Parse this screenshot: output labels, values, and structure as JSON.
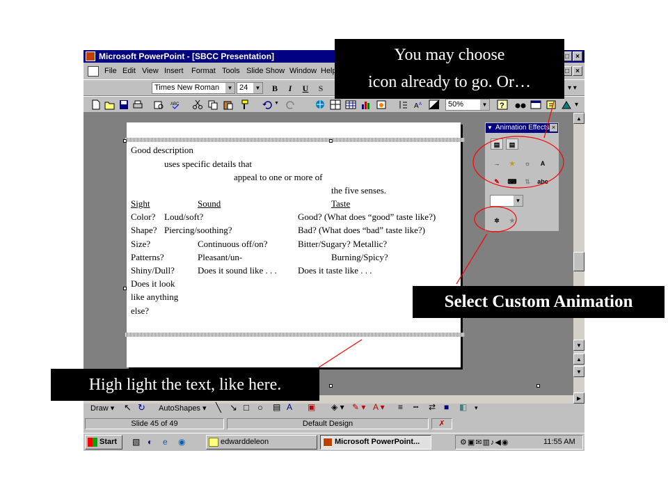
{
  "window": {
    "title": "Microsoft PowerPoint - [SBCC Presentation]"
  },
  "menu": {
    "items": [
      "File",
      "Edit",
      "View",
      "Insert",
      "Format",
      "Tools",
      "Slide Show",
      "Window",
      "Help"
    ]
  },
  "format_toolbar": {
    "font_name": "Times New Roman",
    "font_size": "24",
    "bold": "B",
    "italic": "I",
    "underline": "U",
    "shadow": "S"
  },
  "standard_toolbar": {
    "zoom": "50%"
  },
  "slide": {
    "lines": [
      "Good description",
      "uses specific details that",
      "appeal to one or more of",
      "the five senses."
    ],
    "columns": {
      "sight": {
        "header": "Sight",
        "items": [
          "Color?",
          "Shape?",
          "Size?",
          "Patterns?",
          "Shiny/Dull?",
          "Does it look",
          "like anything",
          "else?"
        ]
      },
      "sound": {
        "header": "Sound",
        "items": [
          "Loud/soft?",
          "Piercing/soothing?",
          "Continuous off/on?",
          "Pleasant/un-",
          "Does it sound like . . ."
        ]
      },
      "taste": {
        "header": "Taste",
        "items": [
          "Good? (What does “good” taste like?)",
          "Bad? (What does “bad” taste like?)",
          "Bitter/Sugary? Metallic?",
          "Burning/Spicy?",
          "Does it taste like . . ."
        ]
      }
    }
  },
  "animation_palette": {
    "title": "Animation Effects"
  },
  "drawing_toolbar": {
    "draw": "Draw",
    "autoshapes": "AutoShapes"
  },
  "status_bar": {
    "slide_info": "Slide 45 of 49",
    "design": "Default Design"
  },
  "taskbar": {
    "start": "Start",
    "tasks": [
      "edwarddeleon",
      "Microsoft PowerPoint..."
    ],
    "clock": "11:55 AM"
  },
  "callouts": {
    "top": [
      "You may choose",
      "icon already to go. Or…"
    ],
    "right": "Select Custom Animation",
    "bottom": "High light the text, like here."
  },
  "colors": {
    "title_bar": "#000080",
    "callout_bg": "#000000",
    "annotation_red": "#ff0000"
  }
}
